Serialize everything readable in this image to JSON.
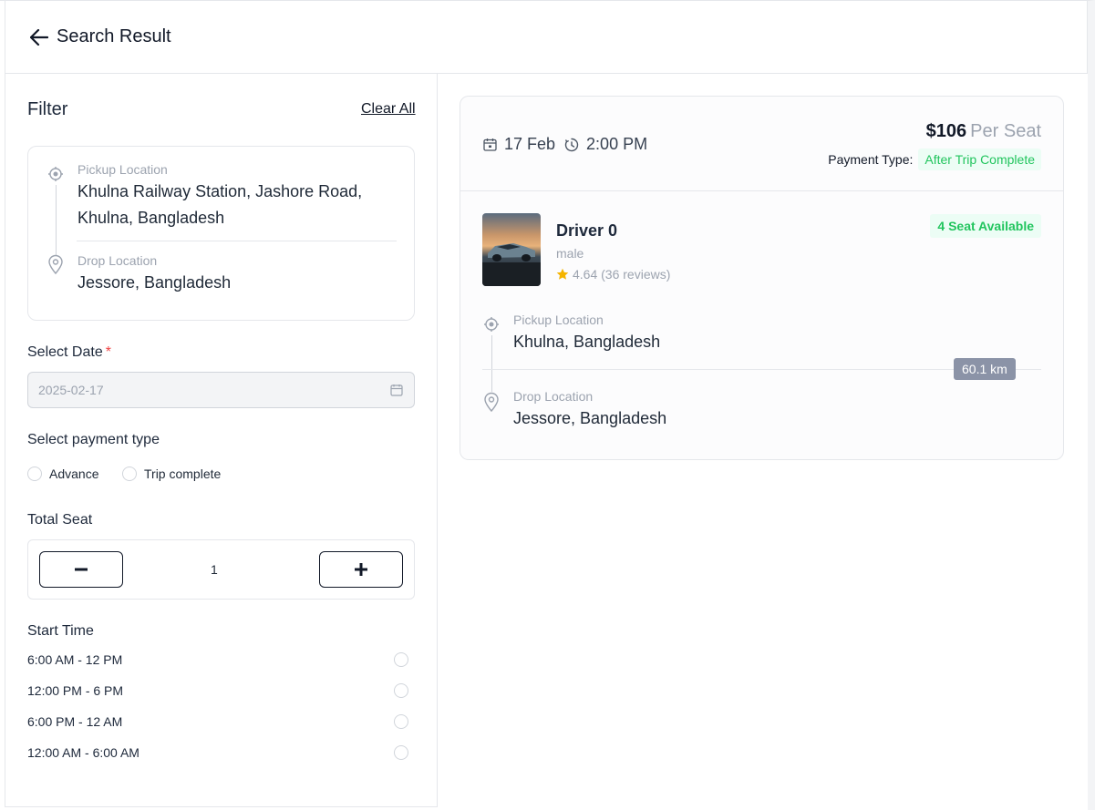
{
  "header": {
    "title": "Search Result"
  },
  "filter": {
    "title": "Filter",
    "clear_all": "Clear All",
    "pickup_label": "Pickup Location",
    "pickup_line1": "Khulna Railway Station, Jashore Road,",
    "pickup_line2": "Khulna, Bangladesh",
    "drop_label": "Drop Location",
    "drop_value": "Jessore, Bangladesh",
    "date_label": "Select Date",
    "date_required": "*",
    "date_value": "2025-02-17",
    "payment_label": "Select payment type",
    "payment_options": [
      "Advance",
      "Trip complete"
    ],
    "seat_label": "Total Seat",
    "seat_count": "1",
    "start_time_label": "Start Time",
    "time_options": [
      "6:00 AM - 12 PM",
      "12:00 PM - 6 PM",
      "6:00 PM - 12 AM",
      "12:00 AM - 6:00 AM"
    ]
  },
  "trip": {
    "date": "17 Feb",
    "time": "2:00 PM",
    "price": "$106",
    "per_seat": "Per Seat",
    "payment_type_label": "Payment Type:",
    "payment_type_value": "After Trip Complete",
    "driver_name": "Driver 0",
    "driver_gender": "male",
    "rating": "4.64 (36 reviews)",
    "seats_available": "4 Seat Available",
    "pickup_label": "Pickup Location",
    "pickup_value": "Khulna, Bangladesh",
    "drop_label": "Drop Location",
    "drop_value": "Jessore, Bangladesh",
    "distance": "60.1 km"
  },
  "colors": {
    "accent_green": "#22c55e",
    "green_bg": "#ecfdf5",
    "star": "#f5b400",
    "distance_bg": "#8b93a7"
  },
  "icons": [
    "arrow-left-icon",
    "target-pin-icon",
    "map-pin-icon",
    "calendar-icon",
    "clock-icon",
    "star-icon"
  ]
}
